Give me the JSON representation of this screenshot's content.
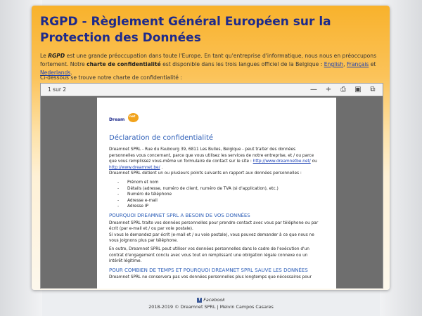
{
  "header": {
    "title": "RGPD - Règlement Général Européen sur la Protection des Données"
  },
  "intro": {
    "p1_a": "Le",
    "p1_b": "RGPD",
    "p1_c": "est une grande préoccupation dans toute l'Europe. En tant qu'entreprise d'informatique, nous nous en préoccupons fortement. Notre",
    "p1_d": "charte de confidentialité",
    "p1_e": "est disponible dans les trois langues officiel de la Belgique :",
    "lang_en": "English",
    "lang_fr": "Français",
    "lang_nl": "Nederlands",
    "sep1": ",",
    "sep2": "et",
    "end": ".",
    "below": "Ci-dessous se trouve notre charte de confidentialité :"
  },
  "viewer": {
    "pages": "1 sur 2",
    "tools": [
      {
        "name": "minus-icon",
        "glyph": "—"
      },
      {
        "name": "plus-icon",
        "glyph": "+"
      },
      {
        "name": "print-icon",
        "glyph": "⎙"
      },
      {
        "name": "save-icon",
        "glyph": "▣"
      },
      {
        "name": "popout-icon",
        "glyph": "⧉"
      }
    ]
  },
  "document": {
    "logo_text": "Dream",
    "logo_badge": "net",
    "title": "Déclaration de confidentialité",
    "p1": "Dreamnet SPRL - Rue du Faubourg 39, 6811 Les Bulles, Belgique - peut traiter des données personnelles vous concernant, parce que vous utilisez les services de notre entreprise, et / ou parce que vous remplissez vous-même un formulaire de contact sur le site :",
    "link1": "http://www.dreamnetbe.net/",
    "p1_or": "ou",
    "link2": "http://www.dreamnet.be/",
    "p1_end": ".",
    "p2": "Dreamnet SPRL détient un ou plusieurs points suivants en rapport aux données personnelles :",
    "list": [
      "Prénom et nom",
      "Détails (adresse, numéro de client, numéro de TVA (si d'application), etc.)",
      "Numéro de téléphone",
      "Adresse e-mail",
      "Adresse IP"
    ],
    "h1": "POURQUOI DREAMNET SPRL A BESOIN DE VOS DONNÉES",
    "p3": "Dreamnet SPRL traite vos données personnelles pour prendre contact avec vous par téléphone ou par écrit (par e-mail et / ou par voie postale).",
    "p4": "Si vous le demandez par écrit (e-mail et / ou voie postale), vous pouvez demander à ce que nous ne vous joignons plus par téléphone.",
    "p5": "En outre, Dreamnet SPRL peut utiliser vos données personnelles dans le cadre de l'exécution d'un contrat d'engagement conclu avec vous tout en remplissant une obligation légale connexe ou un intérêt légitime.",
    "h2": "POUR COMBIEN DE TEMPS ET POURQUOI DREAMNET SPRL SAUVE LES DONNÉES",
    "p6": "Dreamnet SPRL ne conservera pas vos données personnelles plus longtemps que nécessaires pour"
  },
  "footer": {
    "facebook": "Facebook",
    "copyright": "2018-2019 © Dreamnet SPRL | Melvin Campos Casares"
  },
  "colors": {
    "title": "#1d2a8c",
    "accent": "#f8b22c",
    "link": "#1a3fb3",
    "doc_heading": "#2e5fb8"
  }
}
